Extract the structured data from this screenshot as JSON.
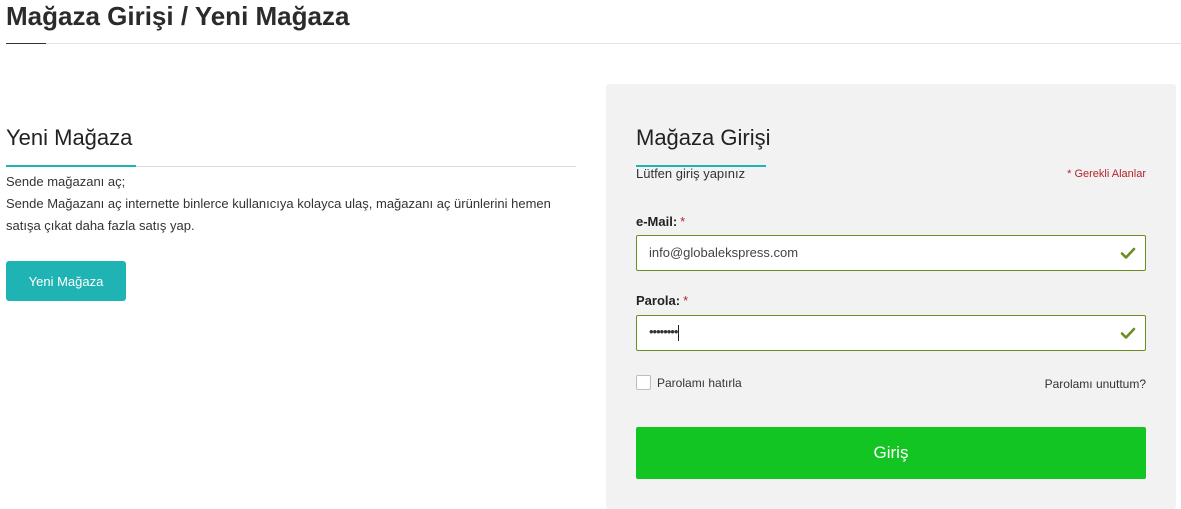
{
  "page": {
    "title": "Mağaza Girişi / Yeni Mağaza"
  },
  "new_store": {
    "heading": "Yeni Mağaza",
    "line1": "Sende mağazanı aç;",
    "line2": "Sende Mağazanı aç internette binlerce kullanıcıya kolayca ulaş, mağazanı aç ürünlerini hemen satışa çıkat daha fazla satış yap.",
    "button_label": "Yeni Mağaza"
  },
  "login": {
    "heading": "Mağaza Girişi",
    "subtitle": "Lütfen giriş yapınız",
    "required_note": "* Gerekli Alanlar",
    "email_label": "e-Mail:",
    "email_value": "info@globalekspress.com",
    "password_label": "Parola:",
    "password_mask": "••••••••",
    "required_star": "*",
    "remember_label": "Parolamı hatırla",
    "forgot_label": "Parolamı unuttum?",
    "submit_label": "Giriş"
  },
  "colors": {
    "accent": "#1fb3b3",
    "submit": "#12c522",
    "valid_border": "#6b8e23",
    "required": "#b3242c"
  },
  "icons": {
    "valid": "check-icon"
  }
}
